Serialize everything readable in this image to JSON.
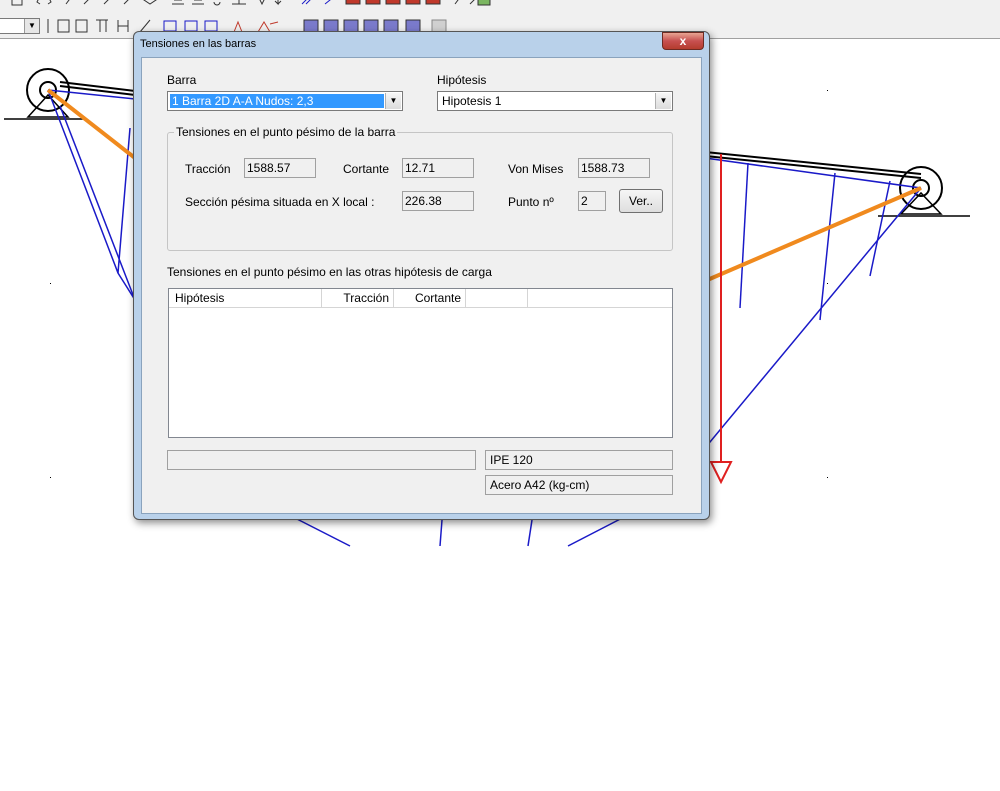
{
  "dialog": {
    "title": "Tensiones en las barras",
    "close_label": "x"
  },
  "barra": {
    "label": "Barra",
    "value": "1  Barra 2D A-A   Nudos: 2,3"
  },
  "hipotesis": {
    "label": "Hipótesis",
    "value": "Hipotesis 1"
  },
  "worst_point": {
    "group_title": "Tensiones en el punto pésimo de la barra",
    "traccion_label": "Tracción",
    "traccion_value": "1588.57",
    "cortante_label": "Cortante",
    "cortante_value": "12.71",
    "von_mises_label": "Von Mises",
    "von_mises_value": "1588.73",
    "seccion_label": "Sección pésima situada en X local :",
    "seccion_value": "226.38",
    "punto_label": "Punto nº",
    "punto_value": "2",
    "ver_button": "Ver.."
  },
  "other_hypotheses": {
    "title": "Tensiones en el punto pésimo en las otras hipótesis de carga",
    "columns": [
      "Hipótesis",
      "Tracción",
      "Cortante",
      "",
      ""
    ]
  },
  "status": {
    "left": "",
    "profile": "IPE 120",
    "material": "Acero A42 (kg-cm)"
  },
  "colors": {
    "member": "#1a1ac8",
    "highlight": "#f08a1e",
    "load": "#e02020",
    "selection": "#3399ff"
  }
}
